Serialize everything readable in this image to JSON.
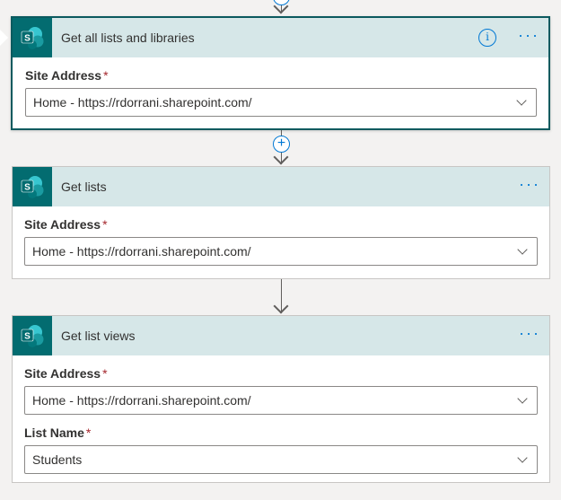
{
  "flow": {
    "steps": [
      {
        "title": "Get all lists and libraries",
        "site_label": "Site Address",
        "required_mark": "*",
        "site_value": "Home - https://rdorrani.sharepoint.com/"
      },
      {
        "title": "Get lists",
        "site_label": "Site Address",
        "required_mark": "*",
        "site_value": "Home - https://rdorrani.sharepoint.com/"
      },
      {
        "title": "Get list views",
        "site_label": "Site Address",
        "required_mark": "*",
        "site_value": "Home - https://rdorrani.sharepoint.com/",
        "list_label": "List Name",
        "list_value": "Students"
      }
    ],
    "icons": {
      "connector": "sharepoint-icon",
      "info": "info-icon",
      "more": "more-options-icon",
      "add": "add-step-icon",
      "dropdown": "chevron-down-icon"
    },
    "colors": {
      "header_bg": "#d6e7e8",
      "sharepoint": "#036c70",
      "accent": "#0078d4",
      "selected_border": "#0b5a5f",
      "required": "#a4262c"
    },
    "glyphs": {
      "info": "i",
      "more": "···",
      "add": "+",
      "sp_letter": "S"
    }
  }
}
